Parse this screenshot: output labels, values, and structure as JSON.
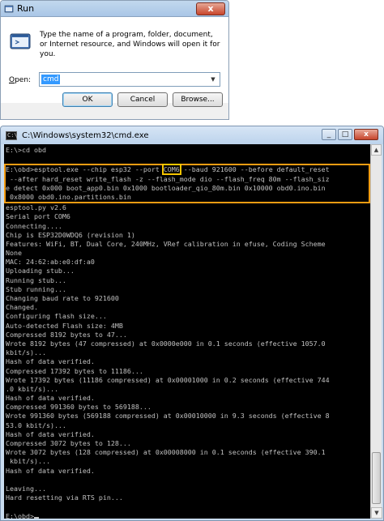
{
  "run_dialog": {
    "title": "Run",
    "close_label": "x",
    "description": "Type the name of a program, folder, document, or Internet resource, and Windows will open it for you.",
    "open_label_prefix": "",
    "open_label_accel": "O",
    "open_label_rest": "pen:",
    "open_value": "cmd",
    "ok_label": "OK",
    "cancel_label": "Cancel",
    "browse_label": "Browse..."
  },
  "cmd_window": {
    "title": "C:\\Windows\\system32\\cmd.exe",
    "icon_text": "C:\\",
    "minimize_label": "_",
    "maximize_label": "□",
    "close_label": "x",
    "prompt_line_1": "E:\\>cd obd",
    "command": {
      "part1": "E:\\obd>esptool.exe --chip esp32 --port ",
      "port": "COM6",
      "part2": " --baud 921600 --before default_reset",
      "line2": " --after hard_reset write_flash -z --flash_mode dio --flash_freq 80m --flash_siz",
      "line3": "e detect 0x000 boot_app0.bin 0x1000 bootloader_qio_80m.bin 0x10000 obd0.ino.bin",
      "line4": " 0x8000 obd0.ino.partitions.bin"
    },
    "output": [
      "esptool.py v2.6",
      "Serial port COM6",
      "Connecting....",
      "Chip is ESP32D0WDQ6 (revision 1)",
      "Features: WiFi, BT, Dual Core, 240MHz, VRef calibration in efuse, Coding Scheme",
      "None",
      "MAC: 24:62:ab:e0:df:a0",
      "Uploading stub...",
      "Running stub...",
      "Stub running...",
      "Changing baud rate to 921600",
      "Changed.",
      "Configuring flash size...",
      "Auto-detected Flash size: 4MB",
      "Compressed 8192 bytes to 47...",
      "Wrote 8192 bytes (47 compressed) at 0x0000e000 in 0.1 seconds (effective 1057.0",
      "kbit/s)...",
      "Hash of data verified.",
      "Compressed 17392 bytes to 11186...",
      "Wrote 17392 bytes (11186 compressed) at 0x00001000 in 0.2 seconds (effective 744",
      ".0 kbit/s)...",
      "Hash of data verified.",
      "Compressed 991360 bytes to 569188...",
      "Wrote 991360 bytes (569188 compressed) at 0x00010000 in 9.3 seconds (effective 8",
      "53.0 kbit/s)...",
      "Hash of data verified.",
      "Compressed 3072 bytes to 128...",
      "Wrote 3072 bytes (128 compressed) at 0x00008000 in 0.1 seconds (effective 390.1",
      " kbit/s)...",
      "Hash of data verified.",
      "",
      "Leaving...",
      "Hard resetting via RTS pin...",
      ""
    ],
    "final_prompt": "E:\\obd>"
  },
  "colors": {
    "console_bg": "#000000",
    "console_text": "#c0c0c0",
    "command_highlight": "#f39c12",
    "port_highlight": "#f5c400"
  }
}
